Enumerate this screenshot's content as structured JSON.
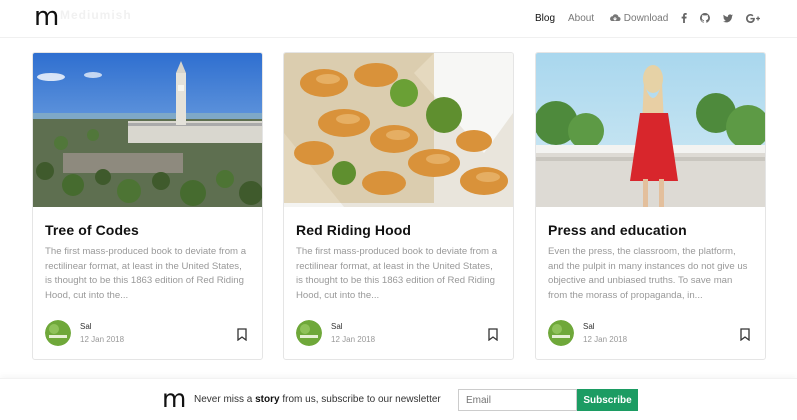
{
  "header": {
    "logo": "m",
    "logo_ghost": "Mediumish",
    "nav": {
      "blog": "Blog",
      "about": "About",
      "download": "Download"
    },
    "icons": [
      "cloud-download-icon",
      "facebook-icon",
      "github-icon",
      "twitter-icon",
      "google-plus-icon"
    ]
  },
  "cards": [
    {
      "title": "Tree of Codes",
      "excerpt": "The first mass-produced book to deviate from a rectilinear format, at least in the United States, is thought to be this 1863 edition of Red Riding Hood, cut into the...",
      "author": "Sal",
      "date": "12 Jan 2018"
    },
    {
      "title": "Red Riding Hood",
      "excerpt": "The first mass-produced book to deviate from a rectilinear format, at least in the United States, is thought to be this 1863 edition of Red Riding Hood, cut into the...",
      "author": "Sal",
      "date": "12 Jan 2018"
    },
    {
      "title": "Press and education",
      "excerpt": "Even the press, the classroom, the platform, and the pulpit in many instances do not give us objective and unbiased truths. To save man from the morass of propaganda, in...",
      "author": "Sal",
      "date": "12 Jan 2018"
    }
  ],
  "footer": {
    "logo": "m",
    "text_before": "Never miss a ",
    "text_bold": "story",
    "text_after": " from us, subscribe to our newsletter",
    "email_placeholder": "Email",
    "subscribe_label": "Subscribe"
  },
  "colors": {
    "accent": "#1c9c63",
    "muted_text": "#999999"
  }
}
